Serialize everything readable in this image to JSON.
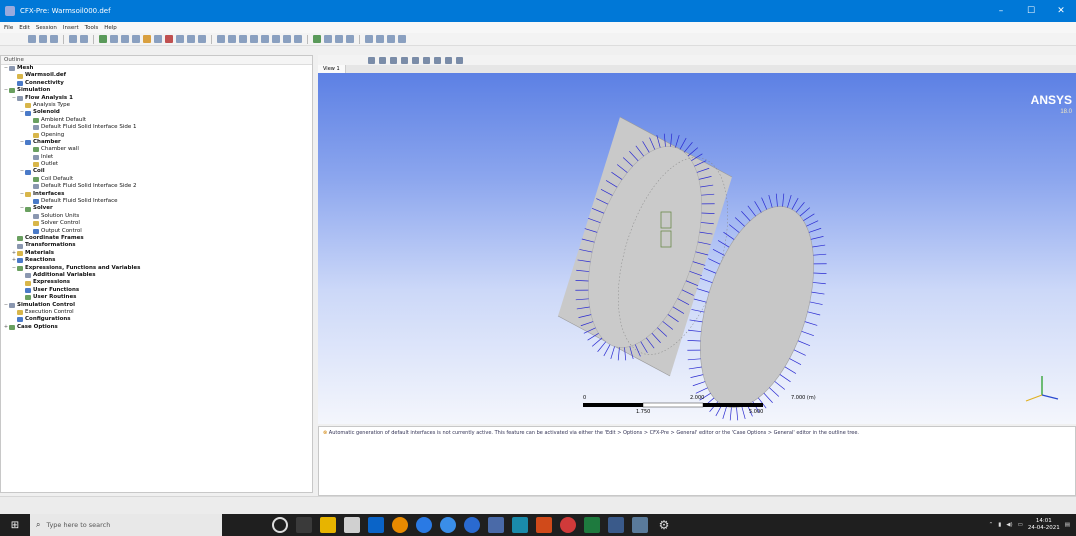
{
  "window": {
    "title": "CFX-Pre: Warmsoil000.def",
    "controls": [
      "–",
      "☐",
      "✕"
    ]
  },
  "menu": [
    "File",
    "Edit",
    "Session",
    "Insert",
    "Tools",
    "Help"
  ],
  "outline": {
    "header": "Outline",
    "items": [
      {
        "depth": 0,
        "exp": "−",
        "label": "Mesh",
        "bold": true,
        "icon": "mesh-icon"
      },
      {
        "depth": 1,
        "exp": "",
        "label": "Warmsoil.def",
        "bold": true,
        "icon": "mesh-file-icon"
      },
      {
        "depth": 1,
        "exp": "",
        "label": "Connectivity",
        "bold": true,
        "icon": "connectivity-icon"
      },
      {
        "depth": 0,
        "exp": "−",
        "label": "Simulation",
        "bold": true,
        "icon": "simulation-icon"
      },
      {
        "depth": 1,
        "exp": "−",
        "label": "Flow Analysis 1",
        "bold": true,
        "icon": "analysis-icon"
      },
      {
        "depth": 2,
        "exp": "",
        "label": "Analysis Type",
        "bold": false,
        "icon": "analysis-type-icon"
      },
      {
        "depth": 2,
        "exp": "−",
        "label": "Solenoid",
        "bold": true,
        "icon": "domain-icon"
      },
      {
        "depth": 3,
        "exp": "",
        "label": "Ambient Default",
        "bold": false,
        "icon": "boundary-icon"
      },
      {
        "depth": 3,
        "exp": "",
        "label": "Default Fluid Solid Interface Side 1",
        "bold": false,
        "icon": "interface-icon"
      },
      {
        "depth": 3,
        "exp": "",
        "label": "Opening",
        "bold": false,
        "icon": "boundary-icon"
      },
      {
        "depth": 2,
        "exp": "−",
        "label": "Chamber",
        "bold": true,
        "icon": "domain-icon"
      },
      {
        "depth": 3,
        "exp": "",
        "label": "Chamber wall",
        "bold": false,
        "icon": "boundary-icon"
      },
      {
        "depth": 3,
        "exp": "",
        "label": "Inlet",
        "bold": false,
        "icon": "boundary-icon"
      },
      {
        "depth": 3,
        "exp": "",
        "label": "Outlet",
        "bold": false,
        "icon": "boundary-icon"
      },
      {
        "depth": 2,
        "exp": "−",
        "label": "Coil",
        "bold": true,
        "icon": "domain-icon"
      },
      {
        "depth": 3,
        "exp": "",
        "label": "Coil Default",
        "bold": false,
        "icon": "boundary-icon"
      },
      {
        "depth": 3,
        "exp": "",
        "label": "Default Fluid Solid Interface Side 2",
        "bold": false,
        "icon": "interface-icon"
      },
      {
        "depth": 2,
        "exp": "−",
        "label": "Interfaces",
        "bold": true,
        "icon": "interfaces-icon"
      },
      {
        "depth": 3,
        "exp": "",
        "label": "Default Fluid Solid Interface",
        "bold": false,
        "icon": "interface-icon"
      },
      {
        "depth": 2,
        "exp": "−",
        "label": "Solver",
        "bold": true,
        "icon": "solver-icon"
      },
      {
        "depth": 3,
        "exp": "",
        "label": "Solution Units",
        "bold": false,
        "icon": "units-icon"
      },
      {
        "depth": 3,
        "exp": "",
        "label": "Solver Control",
        "bold": false,
        "icon": "solver-control-icon"
      },
      {
        "depth": 3,
        "exp": "",
        "label": "Output Control",
        "bold": false,
        "icon": "output-control-icon"
      },
      {
        "depth": 1,
        "exp": "",
        "label": "Coordinate Frames",
        "bold": true,
        "icon": "coord-frame-icon"
      },
      {
        "depth": 1,
        "exp": "",
        "label": "Transformations",
        "bold": true,
        "icon": "transform-icon"
      },
      {
        "depth": 1,
        "exp": "+",
        "label": "Materials",
        "bold": true,
        "icon": "materials-icon"
      },
      {
        "depth": 1,
        "exp": "+",
        "label": "Reactions",
        "bold": true,
        "icon": "reactions-icon"
      },
      {
        "depth": 1,
        "exp": "−",
        "label": "Expressions, Functions and Variables",
        "bold": true,
        "icon": "expressions-icon"
      },
      {
        "depth": 2,
        "exp": "",
        "label": "Additional Variables",
        "bold": true,
        "icon": "variables-icon"
      },
      {
        "depth": 2,
        "exp": "",
        "label": "Expressions",
        "bold": true,
        "icon": "expression-icon"
      },
      {
        "depth": 2,
        "exp": "",
        "label": "User Functions",
        "bold": true,
        "icon": "user-function-icon"
      },
      {
        "depth": 2,
        "exp": "",
        "label": "User Routines",
        "bold": true,
        "icon": "user-routine-icon"
      },
      {
        "depth": 0,
        "exp": "−",
        "label": "Simulation Control",
        "bold": true,
        "icon": "sim-control-icon"
      },
      {
        "depth": 1,
        "exp": "",
        "label": "Execution Control",
        "bold": false,
        "icon": "execution-icon"
      },
      {
        "depth": 1,
        "exp": "",
        "label": "Configurations",
        "bold": true,
        "icon": "config-icon"
      },
      {
        "depth": 0,
        "exp": "+",
        "label": "Case Options",
        "bold": true,
        "icon": "case-options-icon"
      }
    ]
  },
  "viewer": {
    "tab": "View 1",
    "logo": "ANSYS",
    "logo_version": "18.0",
    "scale": {
      "ticks": [
        "0",
        "2.000",
        "7.000 (m)"
      ],
      "subticks": [
        "1.750",
        "5.000"
      ]
    }
  },
  "message": "Automatic generation of default interfaces is not currently active. This feature can be activated via either the 'Edit > Options > CFX-Pre > General' editor or the 'Case Options > General' editor in the outline tree.",
  "taskbar": {
    "search_placeholder": "Type here to search",
    "time": "14:01",
    "date": "24-04-2021"
  },
  "colors": {
    "title": "#0078d7",
    "vector": "#2a2ad0",
    "cylinder": "#c9c9c9"
  }
}
